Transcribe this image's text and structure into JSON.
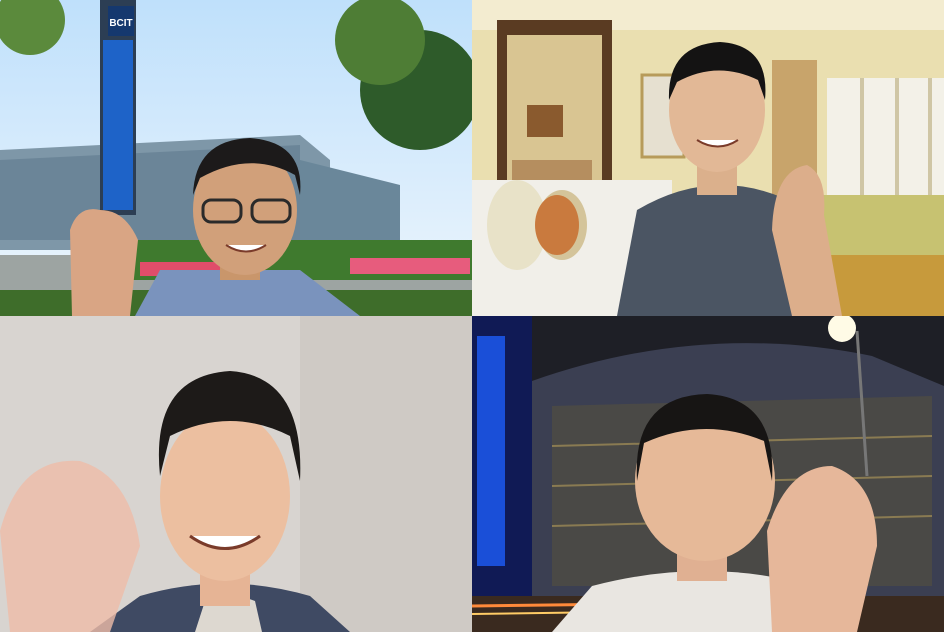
{
  "tiles": [
    {
      "id": "top-left",
      "background": "campus-with-tower",
      "sign_text": "BCIT",
      "colors": {
        "sky": "#d8ecfb",
        "building": "#7e97a8",
        "tower_blue": "#1e63c8",
        "shirt": "#7a93bd"
      }
    },
    {
      "id": "top-right",
      "background": "hotel-room",
      "colors": {
        "wall": "#eadfb0",
        "carpet": "#c79a3c",
        "shirt": "#4b5563"
      }
    },
    {
      "id": "bottom-left",
      "background": "plain-wall",
      "colors": {
        "wall": "#d8d4d0",
        "shirt": "#3f4a63"
      }
    },
    {
      "id": "bottom-right",
      "background": "night-building",
      "colors": {
        "sky": "#1e1f26",
        "glass": "#3b3f52",
        "blue_light": "#1a4fd8",
        "shirt": "#e9e6e1"
      }
    }
  ]
}
